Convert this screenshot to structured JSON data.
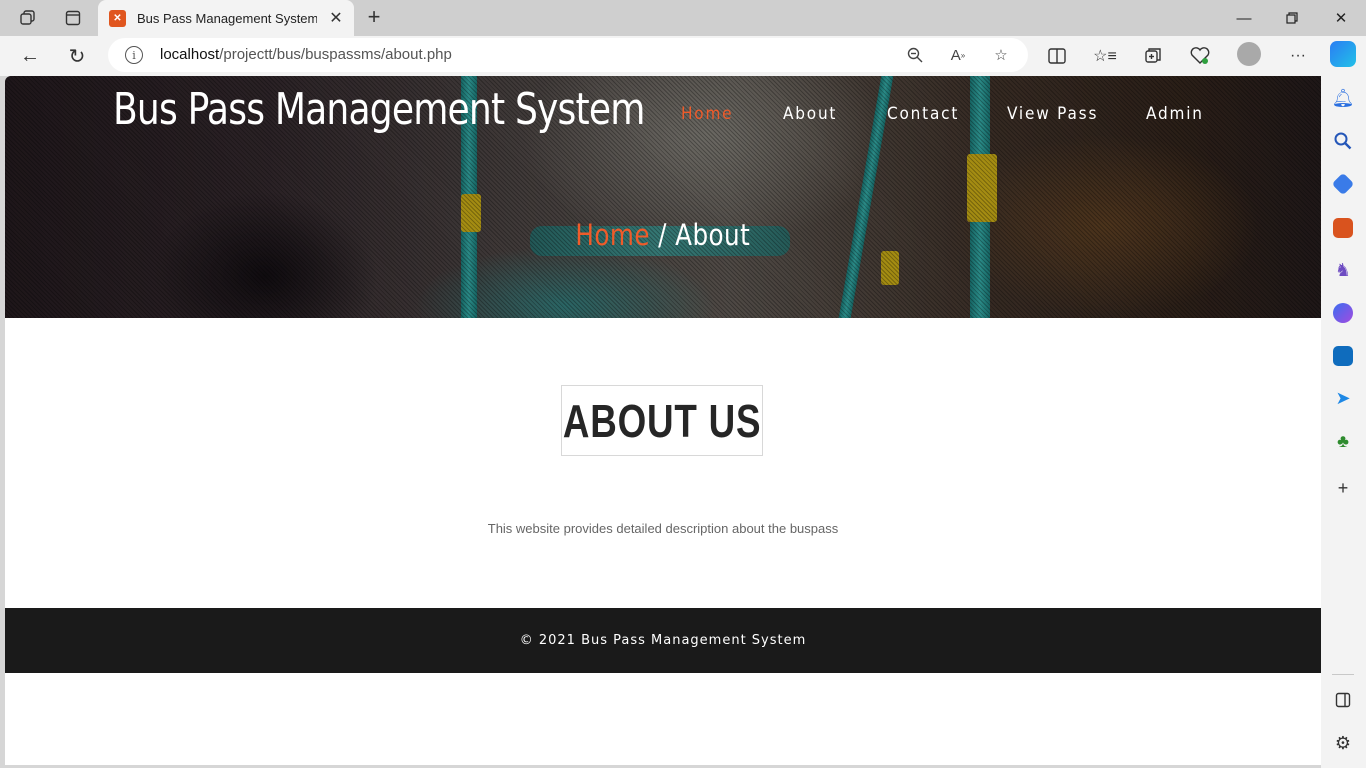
{
  "browser": {
    "tab_title": "Bus Pass Management System || About",
    "tab_icon": "xampp-icon",
    "url_host": "localhost",
    "url_path": "/projectt/bus/buspassms/about.php"
  },
  "site": {
    "brand": "Bus Pass Management System",
    "nav": [
      "Home",
      "About",
      "Contact",
      "View Pass",
      "Admin"
    ],
    "active_nav": "Home",
    "accent_color": "#ef5b2a"
  },
  "breadcrumb": {
    "home": "Home",
    "separator": "/",
    "current": "About"
  },
  "about": {
    "title": "ABOUT US",
    "description": "This website provides detailed description about the buspass"
  },
  "footer": {
    "copyright": "© 2021 Bus Pass Management System"
  }
}
